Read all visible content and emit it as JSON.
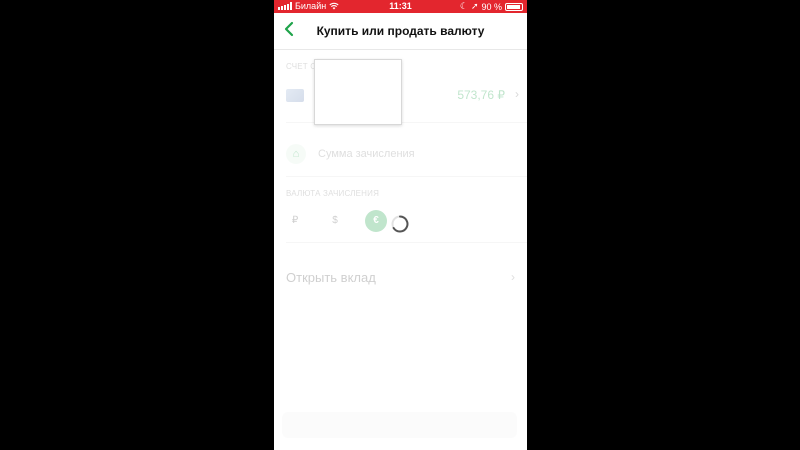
{
  "status_bar": {
    "carrier": "Билайн",
    "time": "11:31",
    "battery": "90 %"
  },
  "nav": {
    "back_icon": "chevron-left-icon",
    "title": "Купить или продать валюту"
  },
  "account": {
    "section_label": "СЧЕТ С",
    "balance": "573,76 ₽"
  },
  "amount": {
    "label": "Сумма зачисления"
  },
  "currency": {
    "section_label": "ВАЛЮТА ЗАЧИСЛЕНИЯ",
    "options": [
      "₽",
      "$",
      "€"
    ],
    "selected": "€"
  },
  "deposit": {
    "label": "Открыть вклад"
  },
  "colors": {
    "status_bar": "#e3262e",
    "accent": "#1fa34a"
  }
}
